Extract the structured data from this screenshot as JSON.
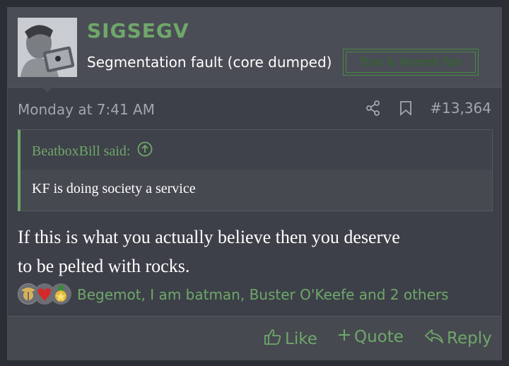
{
  "user": {
    "name": "SIGSEGV",
    "title": "Segmentation fault (core dumped)",
    "banner": "True & Honest Fan"
  },
  "post": {
    "date": "Monday at 7:41 AM",
    "number": "#13,364",
    "share_icon": "share-icon",
    "bookmark_icon": "bookmark-icon"
  },
  "quote": {
    "author": "BeatboxBill said:",
    "text": "KF is doing society a service",
    "jump_icon": "arrow-up-circle-icon"
  },
  "message": {
    "line1": "If this is what you actually believe then you deserve",
    "line2": "to be pelted with rocks."
  },
  "reactions": {
    "text": "Begemot, I am batman, Buster O'Keefe and 2 others",
    "icons": [
      "eagle-globe-anchor-icon",
      "heart-shield-icon",
      "medal-icon"
    ]
  },
  "actions": {
    "like": "Like",
    "quote": "Quote",
    "reply": "Reply"
  },
  "colors": {
    "accent": "#6fa76a",
    "background": "#2b2e34",
    "post_bg": "#3d4048",
    "header_bg": "#4a4d55",
    "text": "#ffffff",
    "muted": "#a3a6ac"
  }
}
